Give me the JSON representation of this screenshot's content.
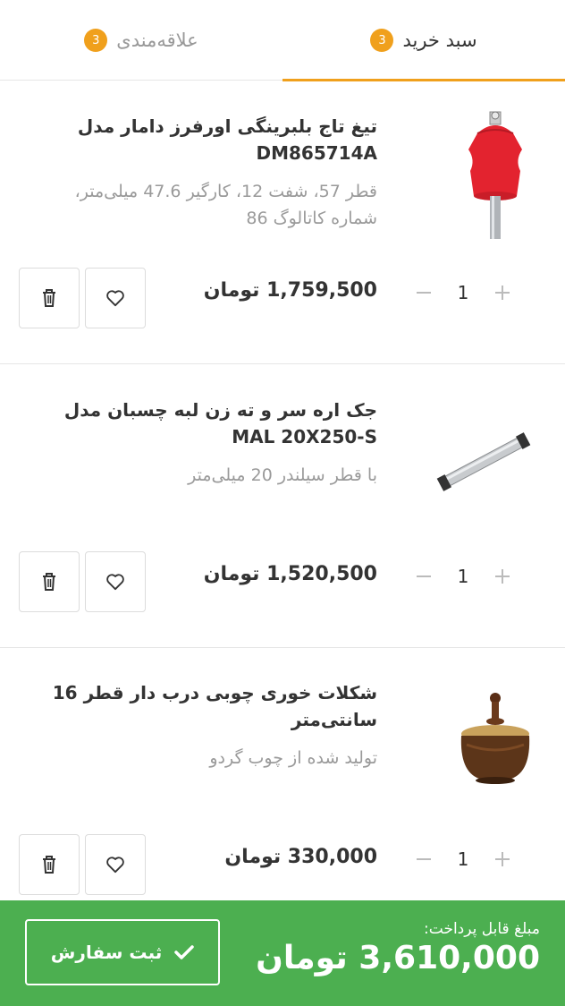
{
  "tabs": [
    {
      "label": "سبد خرید",
      "count": "3",
      "active": true
    },
    {
      "label": "علاقه‌مندی",
      "count": "3",
      "active": false
    }
  ],
  "items": [
    {
      "title": "تیغ تاج بلبرینگی اورفرز دامار مدل DM865714A",
      "desc": "قطر 57، شفت 12، کارگیر 47.6 میلی‌متر، شماره کاتالوگ 86",
      "qty": "1",
      "price_num": "1,759,500",
      "currency": "تومان"
    },
    {
      "title": "جک اره سر و ته زن لبه چسبان مدل MAL 20X250-S",
      "desc": "با قطر سیلندر 20 میلی‌متر",
      "qty": "1",
      "price_num": "1,520,500",
      "currency": "تومان"
    },
    {
      "title": "شکلات خوری چوبی درب دار قطر 16 سانتی‌متر",
      "desc": "تولید شده از چوب گردو",
      "qty": "1",
      "price_num": "330,000",
      "currency": "تومان"
    }
  ],
  "footer": {
    "total_label": "مبلغ قابل پرداخت:",
    "total_num": "3,610,000",
    "currency": "تومان",
    "submit_label": "ثبت سفارش"
  },
  "colors": {
    "accent": "#f0a01c",
    "footer_bg": "#4caf50"
  },
  "icons": {
    "plus": "plus-icon",
    "minus": "minus-icon",
    "heart": "heart-icon",
    "trash": "trash-icon",
    "check": "check-icon"
  }
}
